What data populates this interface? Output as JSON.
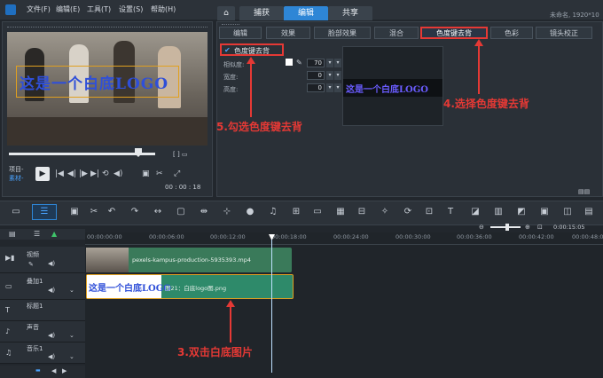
{
  "menubar": {
    "items": [
      "文件(F)",
      "编辑(E)",
      "工具(T)",
      "设置(S)",
      "帮助(H)"
    ],
    "project_info": "未命名, 1920*10"
  },
  "tabs": [
    "捕获",
    "编辑",
    "共享"
  ],
  "preview": {
    "overlay_text": "这是一个白底LOGO",
    "project_label": "项目-",
    "clip_label": "素材-",
    "timecode": "00 : 00 : 18"
  },
  "options": {
    "tabs": [
      "编辑",
      "效果",
      "脸部效果",
      "混合",
      "色度键去背",
      "色彩",
      "镜头校正"
    ],
    "active_tab": "色度键去背",
    "checkbox_label": "色度键去背",
    "checkbox_checked": true,
    "fields": [
      {
        "label": "相似度:",
        "value": "70"
      },
      {
        "label": "宽度:",
        "value": "0"
      },
      {
        "label": "高度:",
        "value": "0"
      }
    ],
    "preview_text": "这是一个白底LOGO"
  },
  "ruler": [
    "00:00:00:00",
    "00:00:06:00",
    "00:00:12:00",
    "00:00:18:00",
    "00:00:24:00",
    "00:00:30:00",
    "00:00:36:00",
    "00:00:42:00",
    "00:00:48:00"
  ],
  "timeline_zoom_time": "0:00:15:05",
  "tracks": [
    {
      "label": "视频"
    },
    {
      "label": "叠加1"
    },
    {
      "label": "标题1"
    },
    {
      "label": "声音"
    },
    {
      "label": "音乐1"
    }
  ],
  "clips": {
    "video": "pexels-kampus-production-5935393.mp4",
    "overlay": "图21：白底logo图.png",
    "overlay_thumb_text": "这是一个白底LOGO"
  },
  "annotations": {
    "step3": "3.双击白底图片",
    "step4": "4.选择色度键去背",
    "step5": "5.勾选色度键去背"
  },
  "colors": {
    "accent": "#2e86d6",
    "annotation": "#e53935",
    "video_clip": "#3a7a5a",
    "overlay_clip": "#2e8a6a"
  }
}
